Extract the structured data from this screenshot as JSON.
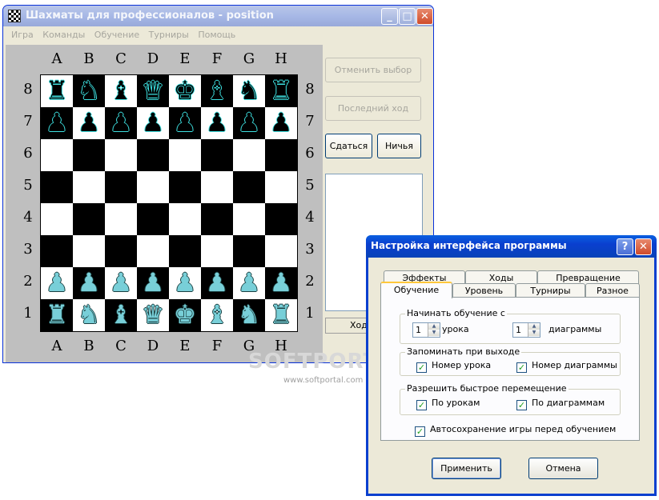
{
  "main_window": {
    "title": "Шахматы для профессионалов - position",
    "buttons": {
      "minimize": "_",
      "maximize": "□",
      "close": "✕"
    },
    "menu": [
      "Игра",
      "Команды",
      "Обучение",
      "Турниры",
      "Помощь"
    ],
    "board": {
      "files": [
        "A",
        "B",
        "C",
        "D",
        "E",
        "F",
        "G",
        "H"
      ],
      "ranks": [
        "8",
        "7",
        "6",
        "5",
        "4",
        "3",
        "2",
        "1"
      ],
      "position": [
        [
          "br",
          "bn",
          "bb",
          "bq",
          "bk",
          "bb",
          "bn",
          "br"
        ],
        [
          "bp",
          "bp",
          "bp",
          "bp",
          "bp",
          "bp",
          "bp",
          "bp"
        ],
        [
          "",
          "",
          "",
          "",
          "",
          "",
          "",
          ""
        ],
        [
          "",
          "",
          "",
          "",
          "",
          "",
          "",
          ""
        ],
        [
          "",
          "",
          "",
          "",
          "",
          "",
          "",
          ""
        ],
        [
          "",
          "",
          "",
          "",
          "",
          "",
          "",
          ""
        ],
        [
          "wp",
          "wp",
          "wp",
          "wp",
          "wp",
          "wp",
          "wp",
          "wp"
        ],
        [
          "wr",
          "wn",
          "wb",
          "wq",
          "wk",
          "wb",
          "wn",
          "wr"
        ]
      ]
    },
    "side_buttons": {
      "cancel_selection": "Отменить выбор",
      "last_move": "Последний ход",
      "resign": "Сдаться",
      "draw": "Ничья"
    },
    "status": "Ход"
  },
  "watermark": {
    "text": "SOFTPORTAL",
    "url": "www.softportal.com"
  },
  "dialog": {
    "title": "Настройка интерфейса программы",
    "buttons": {
      "help": "?",
      "close": "✕"
    },
    "tabs_back": [
      "Эффекты",
      "Ходы",
      "Превращение"
    ],
    "tabs_front": [
      "Обучение",
      "Уровень",
      "Турниры",
      "Разное"
    ],
    "start_group": {
      "title": "Начинать обучение с",
      "lesson_value": "1",
      "lesson_label": "урока",
      "diagram_value": "1",
      "diagram_label": "диаграммы"
    },
    "remember_group": {
      "title": "Запоминать при выходе",
      "lesson_number": {
        "label": "Номер урока",
        "checked": true
      },
      "diagram_number": {
        "label": "Номер диаграммы",
        "checked": true
      }
    },
    "quick_move_group": {
      "title": "Разрешить быстрое перемещение",
      "by_lessons": {
        "label": "По урокам",
        "checked": true
      },
      "by_diagrams": {
        "label": "По диаграммам",
        "checked": true
      }
    },
    "autosave": {
      "label": "Автосохранение игры перед обучением",
      "checked": true
    },
    "apply": "Применить",
    "cancel": "Отмена"
  }
}
